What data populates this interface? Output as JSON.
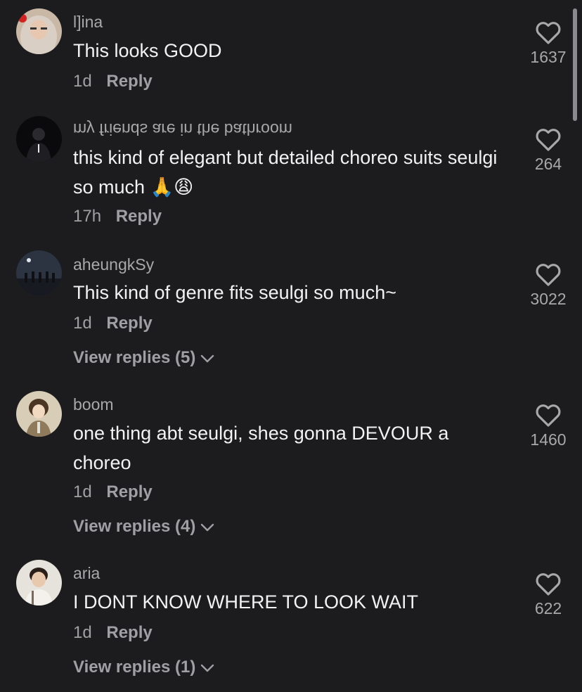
{
  "colors": {
    "background": "#1c1c1e",
    "text": "#f2f2f4",
    "muted": "#a0a0a4"
  },
  "comments": [
    {
      "username": "l]ina",
      "text": "This looks GOOD",
      "time": "1d",
      "reply_label": "Reply",
      "likes": "1637",
      "avatar_icon": "hijab-woman-avatar"
    },
    {
      "username": "my friends are in the bathroom",
      "username_flipped": true,
      "text": "this kind of elegant but detailed choreo suits seulgi so much 🙏😩",
      "time": "17h",
      "reply_label": "Reply",
      "likes": "264",
      "avatar_icon": "dark-person-avatar"
    },
    {
      "username": "aheungkSy",
      "text": "This kind of genre fits seulgi so much~",
      "time": "1d",
      "reply_label": "Reply",
      "likes": "3022",
      "view_replies": "View replies (5)",
      "avatar_icon": "group-stage-avatar"
    },
    {
      "username": "boom",
      "text": "one thing abt seulgi, shes gonna DEVOUR a choreo",
      "time": "1d",
      "reply_label": "Reply",
      "likes": "1460",
      "view_replies": "View replies (4)",
      "avatar_icon": "anime-character-avatar"
    },
    {
      "username": "aria",
      "text": "I DONT KNOW WHERE TO LOOK WAIT",
      "time": "1d",
      "reply_label": "Reply",
      "likes": "622",
      "view_replies": "View replies (1)",
      "avatar_icon": "person-portrait-avatar"
    }
  ]
}
